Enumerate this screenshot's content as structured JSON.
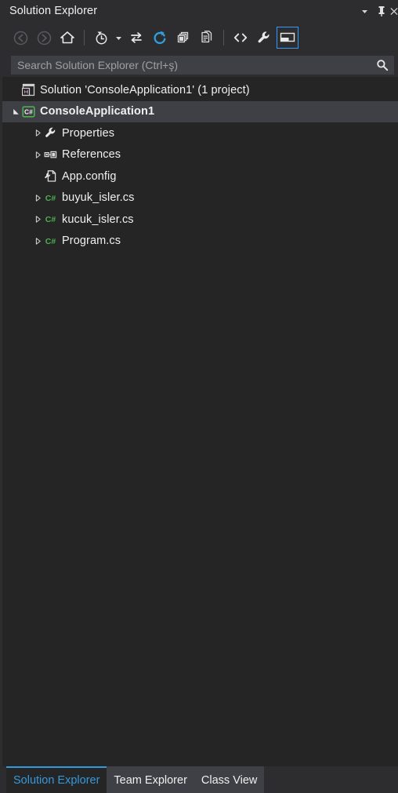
{
  "window": {
    "title": "Solution Explorer",
    "controls": [
      {
        "name": "window-menu-dropdown",
        "icon": "chevron-down-icon"
      },
      {
        "name": "pin-window",
        "icon": "pin-icon"
      },
      {
        "name": "close-window",
        "icon": "close-icon"
      }
    ]
  },
  "toolbar": {
    "items": [
      {
        "name": "back",
        "icon": "back-arrow-icon",
        "label": "Back",
        "state": "disabled"
      },
      {
        "name": "forward",
        "icon": "forward-arrow-icon",
        "label": "Forward",
        "state": "disabled"
      },
      {
        "name": "home",
        "icon": "home-icon",
        "label": "Home",
        "state": "enabled"
      },
      {
        "name": "pending-changes-filter",
        "icon": "clock-filter-icon",
        "label": "Pending Changes Filter",
        "state": "enabled"
      },
      {
        "name": "pending-changes-dropdown",
        "icon": "caret-down-icon",
        "label": "Filter options",
        "state": "enabled"
      },
      {
        "name": "sync-with-active-document",
        "icon": "sync-arrows-icon",
        "label": "Sync with Active Document",
        "state": "enabled"
      },
      {
        "name": "refresh",
        "icon": "refresh-icon",
        "label": "Refresh",
        "state": "enabled"
      },
      {
        "name": "collapse-all",
        "icon": "collapse-all-icon",
        "label": "Collapse All",
        "state": "enabled"
      },
      {
        "name": "show-all-files",
        "icon": "show-all-files-icon",
        "label": "Show All Files",
        "state": "enabled"
      },
      {
        "name": "view-code",
        "icon": "code-brackets-icon",
        "label": "View Code",
        "state": "enabled"
      },
      {
        "name": "properties",
        "icon": "wrench-icon",
        "label": "Properties",
        "state": "enabled"
      },
      {
        "name": "preview-selected-items",
        "icon": "preview-pane-icon",
        "label": "Preview Selected Items",
        "state": "active"
      }
    ]
  },
  "search": {
    "placeholder": "Search Solution Explorer (Ctrl+ş)",
    "value": "",
    "icon": "search-icon"
  },
  "tree": {
    "nodes": [
      {
        "label": "Solution 'ConsoleApplication1' (1 project)",
        "icon": "solution-icon",
        "indent": 0,
        "twisty": "none",
        "selected": false,
        "bold": false
      },
      {
        "label": "ConsoleApplication1",
        "icon": "csharp-project-icon",
        "indent": 1,
        "twisty": "expanded",
        "selected": true,
        "bold": true
      },
      {
        "label": "Properties",
        "icon": "wrench-icon",
        "indent": 2,
        "twisty": "collapsed",
        "selected": false,
        "bold": false
      },
      {
        "label": "References",
        "icon": "references-icon",
        "indent": 2,
        "twisty": "collapsed",
        "selected": false,
        "bold": false
      },
      {
        "label": "App.config",
        "icon": "config-file-icon",
        "indent": 2,
        "twisty": "none",
        "selected": false,
        "bold": false
      },
      {
        "label": "buyuk_isler.cs",
        "icon": "csharp-file-icon",
        "indent": 2,
        "twisty": "collapsed",
        "selected": false,
        "bold": false
      },
      {
        "label": "kucuk_isler.cs",
        "icon": "csharp-file-icon",
        "indent": 2,
        "twisty": "collapsed",
        "selected": false,
        "bold": false
      },
      {
        "label": "Program.cs",
        "icon": "csharp-file-icon",
        "indent": 2,
        "twisty": "collapsed",
        "selected": false,
        "bold": false
      }
    ]
  },
  "tabs": [
    {
      "label": "Solution Explorer",
      "active": true
    },
    {
      "label": "Team Explorer",
      "active": false
    },
    {
      "label": "Class View",
      "active": false
    }
  ],
  "colors": {
    "accent": "#3399dd",
    "toolbar_active_border": "#3399ff",
    "chrome_bg": "#2d2d30",
    "tree_bg": "#252526",
    "selected_row": "#3f3f46",
    "text": "#f0f0f0",
    "muted_text": "#a0a0a0",
    "csharp_green": "#4caf50",
    "solution_purple": "#c586c0",
    "refresh_blue": "#2f9fe0"
  }
}
